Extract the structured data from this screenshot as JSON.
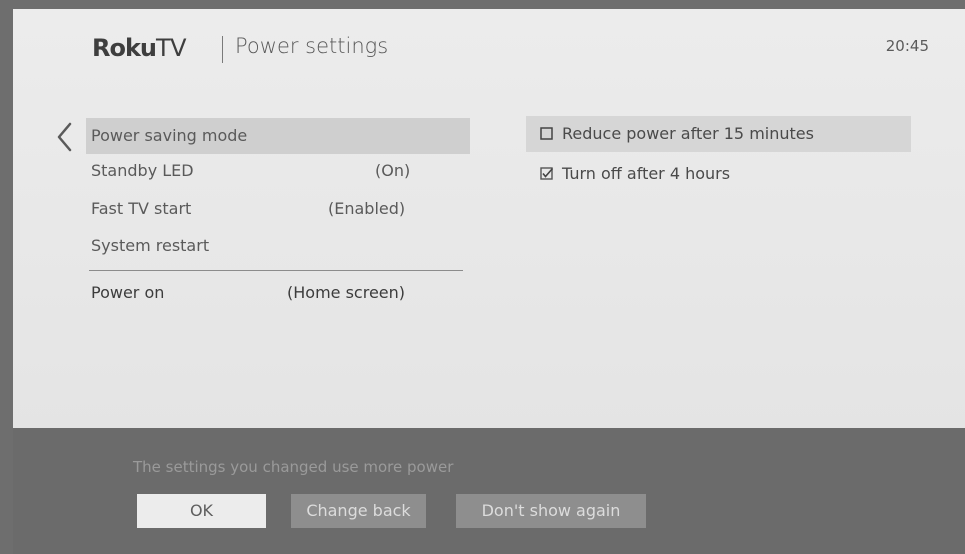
{
  "header": {
    "brand_bold": "Roku",
    "brand_tv": "TV",
    "title": "Power settings",
    "clock": "20:45"
  },
  "menu": {
    "items": [
      {
        "label": "Power saving mode",
        "value": "",
        "selected": true
      },
      {
        "label": "Standby LED",
        "value": "(On)"
      },
      {
        "label": "Fast TV start",
        "value": "(Enabled)"
      },
      {
        "label": "System restart",
        "value": ""
      },
      {
        "label": "Power on",
        "value": "(Home screen)"
      }
    ]
  },
  "options": [
    {
      "label": "Reduce power after 15 minutes",
      "checked": false,
      "highlighted": true
    },
    {
      "label": "Turn off after 4 hours",
      "checked": true
    }
  ],
  "dialog": {
    "message": "The settings you changed use more power",
    "ok_label": "OK",
    "change_back_label": "Change back",
    "dont_show_label": "Don't show again"
  },
  "icons": {
    "back": "chevron-left-icon",
    "unchecked": "checkbox-unchecked-icon",
    "checked": "checkbox-checked-icon"
  }
}
